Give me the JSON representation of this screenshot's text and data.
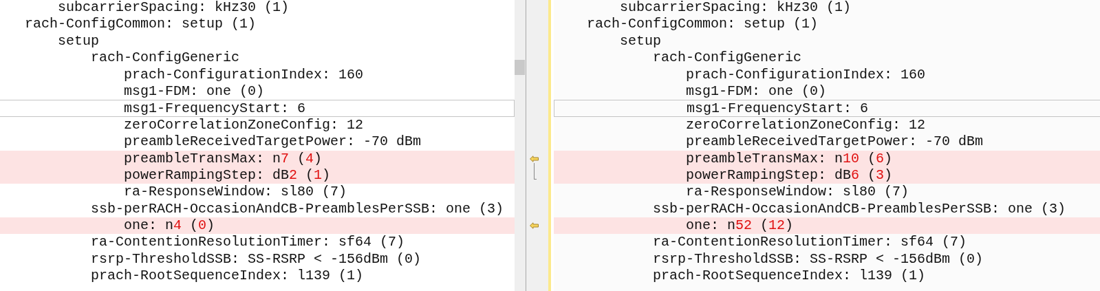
{
  "left": {
    "lines": [
      {
        "children": [
          {
            "text": "subcarrierSpacing: kHz30 (1)",
            "differs": false,
            "cursor": false
          }
        ]
      },
      {
        "text": "rach-ConfigCommon: setup (1)",
        "differs": false,
        "cursor": false,
        "children": [
          {
            "text": "setup",
            "differs": false,
            "cursor": false,
            "children": [
              {
                "text": "rach-ConfigGeneric",
                "differs": false,
                "cursor": false,
                "children": [
                  {
                    "text": "prach-ConfigurationIndex: 160",
                    "differs": false,
                    "cursor": false
                  },
                  {
                    "text": "msg1-FDM: one (0)",
                    "differs": false,
                    "cursor": false
                  },
                  {
                    "text": "msg1-FrequencyStart: 6",
                    "differs": false,
                    "cursor": true
                  },
                  {
                    "text": "zeroCorrelationZoneConfig: 12",
                    "differs": false,
                    "cursor": false
                  },
                  {
                    "text": "preambleReceivedTargetPower: -70 dBm",
                    "differs": false,
                    "cursor": false
                  },
                  {
                    "parts": [
                      {
                        "text": "preambleTransMax: n",
                        "changed": false
                      },
                      {
                        "text": "7",
                        "changed": true
                      },
                      {
                        "text": " (",
                        "changed": false
                      },
                      {
                        "text": "4",
                        "changed": true
                      },
                      {
                        "text": ")",
                        "changed": false
                      }
                    ],
                    "differs": true,
                    "cursor": false
                  },
                  {
                    "parts": [
                      {
                        "text": "powerRampingStep: dB",
                        "changed": false
                      },
                      {
                        "text": "2",
                        "changed": true
                      },
                      {
                        "text": " (",
                        "changed": false
                      },
                      {
                        "text": "1",
                        "changed": true
                      },
                      {
                        "text": ")",
                        "changed": false
                      }
                    ],
                    "differs": true,
                    "cursor": false
                  },
                  {
                    "text": "ra-ResponseWindow: sl80 (7)",
                    "differs": false,
                    "cursor": false
                  }
                ]
              },
              {
                "text": "ssb-perRACH-OccasionAndCB-PreamblesPerSSB: one (3)",
                "differs": false,
                "cursor": false,
                "children": [
                  {
                    "parts": [
                      {
                        "text": "one: n",
                        "changed": false
                      },
                      {
                        "text": "4",
                        "changed": true
                      },
                      {
                        "text": " (",
                        "changed": false
                      },
                      {
                        "text": "0",
                        "changed": true
                      },
                      {
                        "text": ")",
                        "changed": false
                      }
                    ],
                    "differs": true,
                    "cursor": false
                  }
                ]
              },
              {
                "text": "ra-ContentionResolutionTimer: sf64 (7)",
                "differs": false,
                "cursor": false
              },
              {
                "text": "rsrp-ThresholdSSB: SS-RSRP < -156dBm (0)",
                "differs": false,
                "cursor": false
              },
              {
                "text": "prach-RootSequenceIndex: l139 (1)",
                "differs": false,
                "cursor": false
              }
            ]
          }
        ]
      }
    ]
  },
  "right": {
    "lines": [
      {
        "children": [
          {
            "text": "subcarrierSpacing: kHz30 (1)",
            "differs": false,
            "cursor": false
          }
        ]
      },
      {
        "text": "rach-ConfigCommon: setup (1)",
        "differs": false,
        "cursor": false,
        "children": [
          {
            "text": "setup",
            "differs": false,
            "cursor": false,
            "children": [
              {
                "text": "rach-ConfigGeneric",
                "differs": false,
                "cursor": false,
                "children": [
                  {
                    "text": "prach-ConfigurationIndex: 160",
                    "differs": false,
                    "cursor": false
                  },
                  {
                    "text": "msg1-FDM: one (0)",
                    "differs": false,
                    "cursor": false
                  },
                  {
                    "text": "msg1-FrequencyStart: 6",
                    "differs": false,
                    "cursor": true
                  },
                  {
                    "text": "zeroCorrelationZoneConfig: 12",
                    "differs": false,
                    "cursor": false
                  },
                  {
                    "text": "preambleReceivedTargetPower: -70 dBm",
                    "differs": false,
                    "cursor": false
                  },
                  {
                    "parts": [
                      {
                        "text": "preambleTransMax: n",
                        "changed": false
                      },
                      {
                        "text": "10",
                        "changed": true
                      },
                      {
                        "text": " (",
                        "changed": false
                      },
                      {
                        "text": "6",
                        "changed": true
                      },
                      {
                        "text": ")",
                        "changed": false
                      }
                    ],
                    "differs": true,
                    "cursor": false
                  },
                  {
                    "parts": [
                      {
                        "text": "powerRampingStep: dB",
                        "changed": false
                      },
                      {
                        "text": "6",
                        "changed": true
                      },
                      {
                        "text": " (",
                        "changed": false
                      },
                      {
                        "text": "3",
                        "changed": true
                      },
                      {
                        "text": ")",
                        "changed": false
                      }
                    ],
                    "differs": true,
                    "cursor": false
                  },
                  {
                    "text": "ra-ResponseWindow: sl80 (7)",
                    "differs": false,
                    "cursor": false
                  }
                ]
              },
              {
                "text": "ssb-perRACH-OccasionAndCB-PreamblesPerSSB: one (3)",
                "differs": false,
                "cursor": false,
                "children": [
                  {
                    "parts": [
                      {
                        "text": "one: n",
                        "changed": false
                      },
                      {
                        "text": "52",
                        "changed": true
                      },
                      {
                        "text": " (",
                        "changed": false
                      },
                      {
                        "text": "12",
                        "changed": true
                      },
                      {
                        "text": ")",
                        "changed": false
                      }
                    ],
                    "differs": true,
                    "cursor": false
                  }
                ]
              },
              {
                "text": "ra-ContentionResolutionTimer: sf64 (7)",
                "differs": false,
                "cursor": false
              },
              {
                "text": "rsrp-ThresholdSSB: SS-RSRP < -156dBm (0)",
                "differs": false,
                "cursor": false
              },
              {
                "text": "prach-RootSequenceIndex: l139 (1)",
                "differs": false,
                "cursor": false
              }
            ]
          }
        ]
      }
    ]
  }
}
